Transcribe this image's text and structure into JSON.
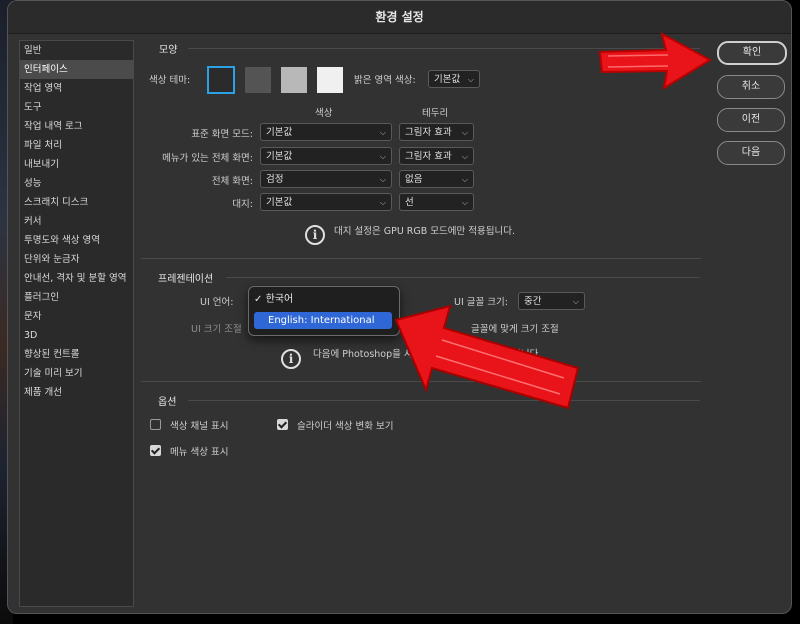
{
  "window": {
    "title": "환경 설정"
  },
  "sidebar": {
    "items": [
      {
        "label": "일반"
      },
      {
        "label": "인터페이스"
      },
      {
        "label": "작업 영역"
      },
      {
        "label": "도구"
      },
      {
        "label": "작업 내역 로그"
      },
      {
        "label": "파일 처리"
      },
      {
        "label": "내보내기"
      },
      {
        "label": "성능"
      },
      {
        "label": "스크래치 디스크"
      },
      {
        "label": "커서"
      },
      {
        "label": "투명도와 색상 영역"
      },
      {
        "label": "단위와 눈금자"
      },
      {
        "label": "안내선, 격자 및 분할 영역"
      },
      {
        "label": "플러그인"
      },
      {
        "label": "문자"
      },
      {
        "label": "3D"
      },
      {
        "label": "향상된 컨트롤"
      },
      {
        "label": "기술 미리 보기"
      },
      {
        "label": "제품 개선"
      }
    ],
    "selected_index": 1
  },
  "appearance": {
    "section_title": "모양",
    "color_theme_label": "색상 테마:",
    "theme_swatches": [
      "#2b2b2b",
      "#545454",
      "#b8b8b8",
      "#f0f0f0"
    ],
    "selected_swatch_index": 0,
    "highlight_label": "밝은 영역 색상:",
    "highlight_value": "기본값",
    "col_color_header": "색상",
    "col_border_header": "테두리",
    "rows": [
      {
        "label": "표준 화면 모드:",
        "color": "기본값",
        "border": "그림자 효과"
      },
      {
        "label": "메뉴가 있는 전체 화면:",
        "color": "기본값",
        "border": "그림자 효과"
      },
      {
        "label": "전체 화면:",
        "color": "검정",
        "border": "없음"
      },
      {
        "label": "대지:",
        "color": "기본값",
        "border": "선"
      }
    ],
    "info_text": "대지 설정은 GPU RGB 모드에만 적용됩니다."
  },
  "presentation": {
    "section_title": "프레젠테이션",
    "ui_language_label": "UI 언어:",
    "ui_scaling_label": "UI 크기 조절",
    "font_size_label": "UI 글꼴 크기:",
    "font_size_value": "중간",
    "scale_text_label": "글꼴에 맞게 크기 조절",
    "info_text": "다음에 Photoshop을 시작할 때 변경 사항이 적용됩니다."
  },
  "language_popup": {
    "options": [
      {
        "label": "한국어",
        "checked": true
      },
      {
        "label": "English: International",
        "highlighted": true
      }
    ]
  },
  "options": {
    "section_title": "옵션",
    "checkboxes": [
      {
        "label": "색상 채널 표시",
        "checked": false
      },
      {
        "label": "슬라이더 색상 변화 보기",
        "checked": true
      },
      {
        "label": "메뉴 색상 표시",
        "checked": true
      }
    ]
  },
  "buttons": {
    "ok": "확인",
    "cancel": "취소",
    "prev": "이전",
    "next": "다음"
  },
  "annotation_color": "#e8141a"
}
